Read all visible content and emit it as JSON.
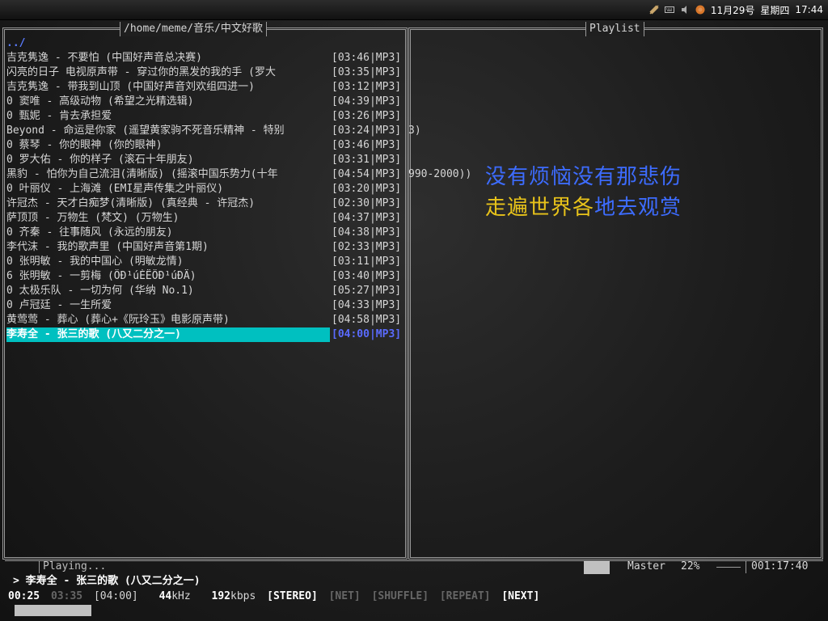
{
  "topbar": {
    "date": "11月29号",
    "weekday": "星期四",
    "time": "17:44"
  },
  "browser": {
    "path": "/home/meme/音乐/中文好歌",
    "parent": "../",
    "items": [
      {
        "title": "吉克隽逸 - 不要怕 (中国好声音总决赛)",
        "meta": "[03:46|MP3]",
        "overflow": ""
      },
      {
        "title": "闪亮的日子 电视原声带 - 穿过你的黑发的我的手 (罗大",
        "meta": "[03:35|MP3]",
        "overflow": ""
      },
      {
        "title": "吉克隽逸 - 带我到山顶 (中国好声音刘欢组四进一)",
        "meta": "[03:12|MP3]",
        "overflow": ""
      },
      {
        "title": "0 窦唯 - 高级动物 (希望之光精选辑)",
        "meta": "[04:39|MP3]",
        "overflow": ""
      },
      {
        "title": "0 甄妮 - 肯去承担爱",
        "meta": "[03:26|MP3]",
        "overflow": ""
      },
      {
        "title": "Beyond - 命运是你家 (遥望黄家驹不死音乐精神 - 特别",
        "meta": "[03:24|MP3]",
        "overflow": "3)"
      },
      {
        "title": "0 蔡琴 - 你的眼神 (你的眼神)",
        "meta": "[03:46|MP3]",
        "overflow": ""
      },
      {
        "title": "0 罗大佑 - 你的样子 (滚石十年朋友)",
        "meta": "[03:31|MP3]",
        "overflow": ""
      },
      {
        "title": "黑豹 - 怕你为自己流泪(清晰版) (摇滚中国乐势力(十年",
        "meta": "[04:54|MP3]",
        "overflow": "990-2000))"
      },
      {
        "title": "0 叶丽仪 - 上海滩 (EMI星声传集之叶丽仪)",
        "meta": "[03:20|MP3]",
        "overflow": ""
      },
      {
        "title": "许冠杰 - 天才白痴梦(清晰版) (真经典 - 许冠杰)",
        "meta": "[02:30|MP3]",
        "overflow": ""
      },
      {
        "title": "萨顶顶 - 万物生 (梵文) (万物生)",
        "meta": "[04:37|MP3]",
        "overflow": ""
      },
      {
        "title": "0 齐秦 - 往事随风 (永远的朋友)",
        "meta": "[04:38|MP3]",
        "overflow": ""
      },
      {
        "title": "李代沫 - 我的歌声里 (中国好声音第1期)",
        "meta": "[02:33|MP3]",
        "overflow": ""
      },
      {
        "title": "0 张明敏 - 我的中国心 (明敏龙情)",
        "meta": "[03:11|MP3]",
        "overflow": ""
      },
      {
        "title": "6 张明敏 - 一剪梅 (ÖÐ¹úÈËÖÐ¹úÐÄ)",
        "meta": "[03:40|MP3]",
        "overflow": ""
      },
      {
        "title": "0 太极乐队 - 一切为何 (华纳 No.1)",
        "meta": "[05:27|MP3]",
        "overflow": ""
      },
      {
        "title": "0 卢冠廷 - 一生所爱",
        "meta": "[04:33|MP3]",
        "overflow": ""
      },
      {
        "title": "黄莺莺 - 葬心 (葬心+《阮玲玉》电影原声带)",
        "meta": "[04:58|MP3]",
        "overflow": ""
      },
      {
        "title": "李寿全 - 张三的歌 (八又二分之一)",
        "meta": "[04:00|MP3]",
        "overflow": "",
        "selected": true
      }
    ]
  },
  "playlist": {
    "title": "Playlist"
  },
  "lyrics": {
    "line1": "没有烦恼没有那悲伤",
    "line2_a": "走遍世界各",
    "line2_b": "地去观赏"
  },
  "status": {
    "state": "Playing...",
    "mixer": "Master",
    "volume": "22%",
    "elapsed_total": "001:17:40"
  },
  "now_playing": {
    "line": "> 李寿全 - 张三的歌 (八又二分之一)",
    "position": "00:25",
    "remaining": "03:35",
    "duration": "[04:00]",
    "khz_value": "44",
    "khz_unit": "kHz",
    "kbps_value": "192",
    "kbps_unit": "kbps",
    "stereo": "[STEREO]",
    "net": "[NET]",
    "shuffle": "[SHUFFLE]",
    "repeat": "[REPEAT]",
    "next": "[NEXT]",
    "progress": 0.104
  }
}
